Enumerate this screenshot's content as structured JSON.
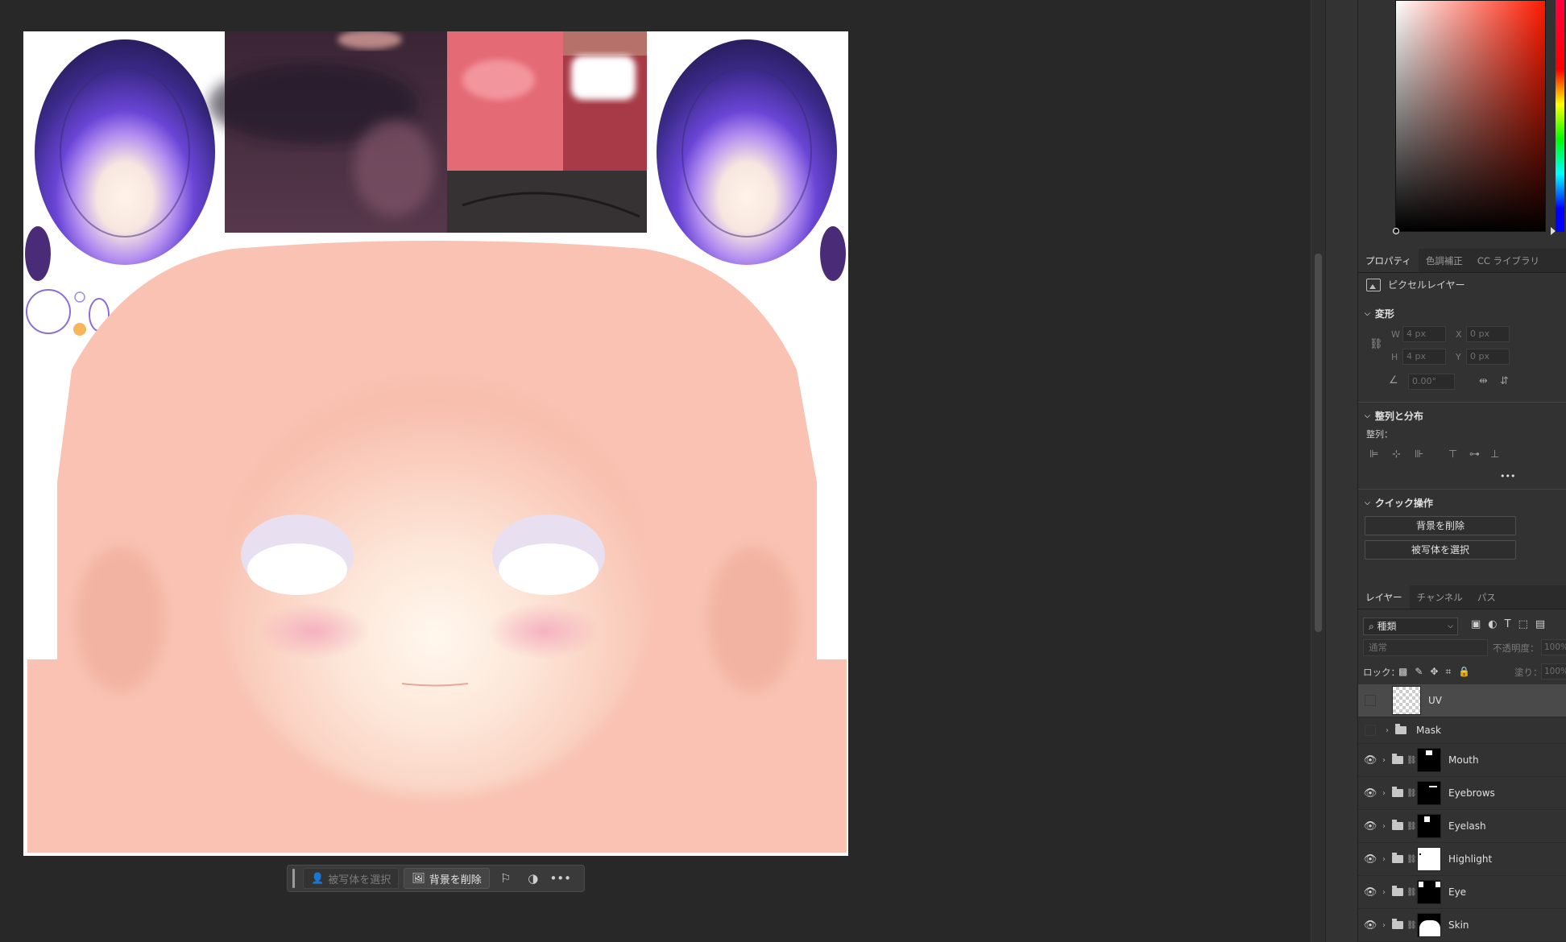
{
  "context_bar": {
    "select_subject": "被写体を選択",
    "remove_background": "背景を削除",
    "more": "•••"
  },
  "properties_tabs": [
    "プロパティ",
    "色調補正",
    "CC ライブラリ"
  ],
  "properties": {
    "layer_type": "ピクセルレイヤー",
    "transform_title": "変形",
    "w_label": "W",
    "w_value": "4 px",
    "x_label": "X",
    "x_value": "0 px",
    "h_label": "H",
    "h_value": "4 px",
    "y_label": "Y",
    "y_value": "0 px",
    "angle_value": "0.00°",
    "align_title": "整列と分布",
    "align_label": "整列：",
    "more": "•••",
    "quick_title": "クイック操作",
    "quick_remove_bg": "背景を削除",
    "quick_select_subject": "被写体を選択"
  },
  "layers_tabs": [
    "レイヤー",
    "チャンネル",
    "パス"
  ],
  "layers_panel": {
    "filter_kind": "種類",
    "blend_mode": "通常",
    "opacity_label": "不透明度：",
    "opacity_value": "100%",
    "lock_label": "ロック：",
    "fill_label": "塗り：",
    "fill_value": "100%"
  },
  "layers": [
    {
      "name": "UV",
      "visible": false,
      "selected": true
    },
    {
      "name": "Mask",
      "visible": false
    },
    {
      "name": "Mouth",
      "visible": true
    },
    {
      "name": "Eyebrows",
      "visible": true
    },
    {
      "name": "Eyelash",
      "visible": true
    },
    {
      "name": "Highlight",
      "visible": true
    },
    {
      "name": "Eye",
      "visible": true
    },
    {
      "name": "Skin",
      "visible": true
    }
  ],
  "colors": {
    "workspace": "#282828",
    "panel": "#323232",
    "skin": "#f9c2b2",
    "iris_top": "#2a1d5e",
    "iris_mid": "#6a45d6",
    "lip": "#e46a75"
  }
}
